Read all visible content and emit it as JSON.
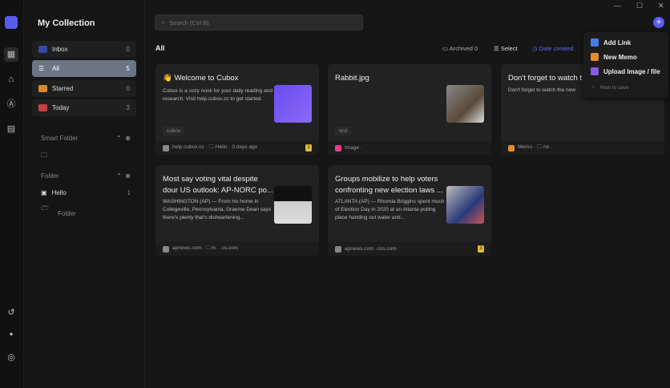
{
  "rail": {
    "icons": [
      "grid-icon",
      "tag-icon",
      "compass-icon",
      "archive-icon",
      "history-icon",
      "dot-icon",
      "settings-icon"
    ]
  },
  "sidebar": {
    "title": "My Collection",
    "items": [
      {
        "label": "Inbox",
        "count": "0",
        "color": "#3a47a8"
      },
      {
        "label": "All",
        "count": "5",
        "color": "#ffffff"
      },
      {
        "label": "Starred",
        "count": "0",
        "color": "#d98a2a"
      },
      {
        "label": "Today",
        "count": "3",
        "color": "#c84040"
      }
    ],
    "smart_folder": "Smart Folder",
    "folder": "Folder",
    "folders": [
      {
        "label": "Hello",
        "count": "1"
      }
    ],
    "new_folder": "Folder"
  },
  "header": {
    "search_placeholder": "Search (Ctrl B)",
    "title": "All",
    "archived": "Archived 0",
    "select": "Select",
    "sort": "Date created"
  },
  "menu": {
    "items": [
      {
        "label": "Add Link",
        "color": "#4a7be8"
      },
      {
        "label": "New Memo",
        "color": "#e88a2a"
      },
      {
        "label": "Upload Image / file",
        "color": "#8a5ae0"
      }
    ],
    "how": "How to save"
  },
  "cards": [
    {
      "title": "👋 Welcome to Cubox",
      "desc": "Cubox is a cozy nook for your daily reading and research. Visit help.cubox.cc to get started.",
      "tag": "cubox",
      "footer": "help.cubox.cc · 🗀 Hello · 3 days ago",
      "badge": "1"
    },
    {
      "title": "Rabbit.jpg",
      "desc": "",
      "tag": "test",
      "footer": "Image ·",
      "badge": ""
    },
    {
      "title": "Don't forget to watch t",
      "desc": "Don't forget to watch the new",
      "tag": "",
      "footer": "Memo · 🗀 no ·",
      "badge": ""
    },
    {
      "title": "Most say voting vital despite dour US outlook: AP-NORC po...",
      "desc": "WASHINGTON (AP) — From his home in Collegeville, Pennsylvania, Graeme Dean says there's plenty that's disheartening...",
      "tag": "",
      "footer": "apnews.com · 🗀m · .cs.com",
      "badge": ""
    },
    {
      "title": "Groups mobilize to help voters confronting new election laws ...",
      "desc": "ATLANTA (AP) — Rhonda Briggins spent much of Election Day in 2020 at an Atlanta polling place handing out water and...",
      "tag": "",
      "footer": "apnews.com ·cos.com",
      "badge": "3"
    }
  ]
}
